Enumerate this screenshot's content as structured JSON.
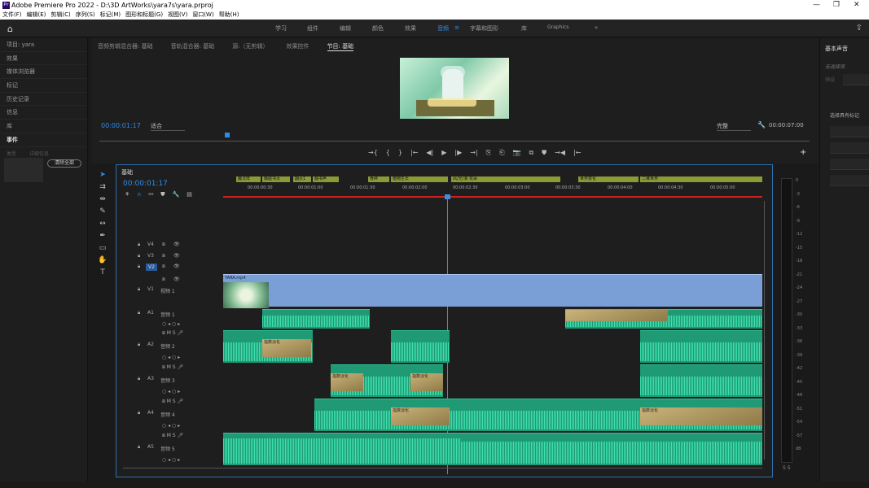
{
  "window": {
    "title": "Adobe Premiere Pro 2022 - D:\\3D ArtWorks\\yara7s\\yara.prproj",
    "app_icon": "Pr"
  },
  "menu": [
    "文件(F)",
    "编辑(E)",
    "剪辑(C)",
    "序列(S)",
    "标记(M)",
    "图形和标题(G)",
    "视图(V)",
    "窗口(W)",
    "帮助(H)"
  ],
  "workspaces": {
    "tabs": [
      "学习",
      "组件",
      "编辑",
      "颜色",
      "效果",
      "音频",
      "字幕和图形",
      "库",
      "Graphics"
    ],
    "active": "音频",
    "more": "»"
  },
  "left_panel": {
    "items": [
      "项目: yara",
      "效果",
      "媒体浏览器",
      "标记",
      "历史记录",
      "信息",
      "库",
      "事件"
    ],
    "sub_labels": [
      "类型",
      "详细信息"
    ],
    "clear_all": "清除全部"
  },
  "monitor": {
    "tabs": [
      "音频剪辑混合器: 基础",
      "音轨混合器: 基础",
      "源:（无剪辑）",
      "效果控件",
      "节目: 基础"
    ],
    "active_tab": "节目: 基础",
    "timecode": "00:00:01:17",
    "fit": "适合",
    "quality": "完整",
    "duration": "00:00:07:00",
    "wrench_icon": "wrench-icon"
  },
  "transport": [
    "→{",
    "{",
    "}",
    "|←",
    "◀|",
    "▶",
    "|▶",
    "→|",
    "⎘",
    "⎗",
    "📷",
    "⧉",
    "⛊",
    "→◀",
    "|←"
  ],
  "timeline": {
    "sequence": "基础",
    "timecode": "00:00:01:17",
    "markers": [
      {
        "label": "魔法阵"
      },
      {
        "label": "触碰书页"
      },
      {
        "label": "翻页1"
      },
      {
        "label": "翻书声"
      },
      {
        "label": "骨碎"
      },
      {
        "label": "植物生长"
      },
      {
        "label": "风/光/浪 花朵"
      },
      {
        "label": "世界变化"
      },
      {
        "label": "二维世界"
      }
    ],
    "ticks": [
      "00:00:00:30",
      "00:00:01:00",
      "00:00:01:30",
      "00:00:02:00",
      "00:00:02:30",
      "00:00:03:00",
      "00:00:03:30",
      "00:00:04:00",
      "00:00:04:30",
      "00:00:05:00"
    ],
    "video_tracks": [
      {
        "id": "V4"
      },
      {
        "id": "V3"
      },
      {
        "id": "V2"
      },
      {
        "id": "V1",
        "name": "视频 1"
      }
    ],
    "audio_tracks": [
      {
        "id": "A1",
        "name": "音频 1"
      },
      {
        "id": "A2",
        "name": "音频 2"
      },
      {
        "id": "A3",
        "name": "音频 3"
      },
      {
        "id": "A4",
        "name": "音频 4"
      },
      {
        "id": "A5",
        "name": "音频 5"
      }
    ],
    "video_clip": {
      "name": "YARA.mp4"
    },
    "crossfade_label": "指数淡化",
    "meter_levels": [
      "0",
      "-3",
      "-6",
      "-9",
      "-12",
      "-15",
      "-18",
      "-21",
      "-24",
      "-27",
      "-30",
      "-33",
      "-36",
      "-39",
      "-42",
      "-45",
      "-48",
      "-51",
      "-54",
      "-57",
      "dB"
    ],
    "meter_solo": "S  S"
  },
  "right_panel": {
    "title": "基本声音",
    "no_selection": "无选择项",
    "preset": "预设",
    "hint": "选择具有标记"
  },
  "colors": {
    "accent": "#2d8ceb",
    "audio_clip": "#1f9a74",
    "video_clip": "#7a9fd6",
    "marker": "#8a9a35",
    "playhead": "#3b8fe0"
  }
}
